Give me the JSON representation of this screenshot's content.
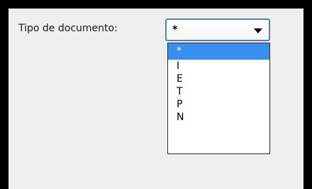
{
  "form": {
    "label": "Tipo de documento:",
    "select": {
      "value": "*",
      "options": [
        "*",
        "I",
        "E",
        "T",
        "P",
        "N"
      ],
      "highlighted": "*"
    }
  },
  "colors": {
    "highlight": "#3a8ef0",
    "panel": "#efefef",
    "frame": "#000000"
  }
}
